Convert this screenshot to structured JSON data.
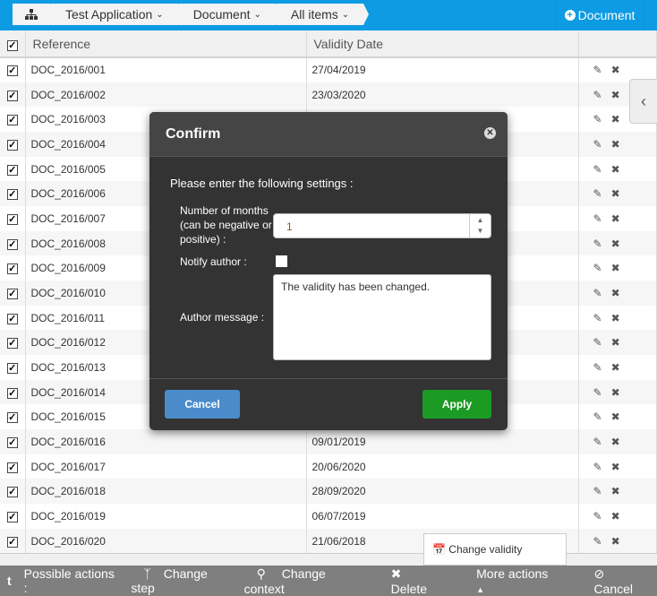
{
  "breadcrumb": {
    "home_icon": "sitemap-icon",
    "items": [
      "Test Application",
      "Document",
      "All items"
    ]
  },
  "new_document_label": "Document",
  "table": {
    "headers": [
      "Reference",
      "Validity Date"
    ],
    "rows": [
      [
        "DOC_2016/001",
        "27/04/2019"
      ],
      [
        "DOC_2016/002",
        "23/03/2020"
      ],
      [
        "DOC_2016/003",
        ""
      ],
      [
        "DOC_2016/004",
        ""
      ],
      [
        "DOC_2016/005",
        ""
      ],
      [
        "DOC_2016/006",
        ""
      ],
      [
        "DOC_2016/007",
        ""
      ],
      [
        "DOC_2016/008",
        ""
      ],
      [
        "DOC_2016/009",
        ""
      ],
      [
        "DOC_2016/010",
        ""
      ],
      [
        "DOC_2016/011",
        ""
      ],
      [
        "DOC_2016/012",
        ""
      ],
      [
        "DOC_2016/013",
        ""
      ],
      [
        "DOC_2016/014",
        ""
      ],
      [
        "DOC_2016/015",
        ""
      ],
      [
        "DOC_2016/016",
        "09/01/2019"
      ],
      [
        "DOC_2016/017",
        "20/06/2020"
      ],
      [
        "DOC_2016/018",
        "28/09/2020"
      ],
      [
        "DOC_2016/019",
        "06/07/2019"
      ],
      [
        "DOC_2016/020",
        "21/06/2018"
      ]
    ]
  },
  "dialog": {
    "title": "Confirm",
    "intro": "Please enter the following settings :",
    "months_label": "Number of months (can be negative or positive) :",
    "months_value": "1",
    "notify_label": "Notify author :",
    "notify_checked": false,
    "message_label": "Author message :",
    "message_value": "The validity has been changed.",
    "cancel": "Cancel",
    "apply": "Apply"
  },
  "more_menu": {
    "items": [
      "Change validity"
    ]
  },
  "footer": {
    "toggle": "t",
    "possible": "Possible actions :",
    "change_step": "Change step",
    "change_context": "Change context",
    "delete": "Delete",
    "more": "More actions",
    "cancel": "Cancel"
  },
  "colors": {
    "topbar": "#0d9be3",
    "apply": "#1b9a24",
    "cancel": "#4a8ccb",
    "footer": "#7f7f7f"
  }
}
